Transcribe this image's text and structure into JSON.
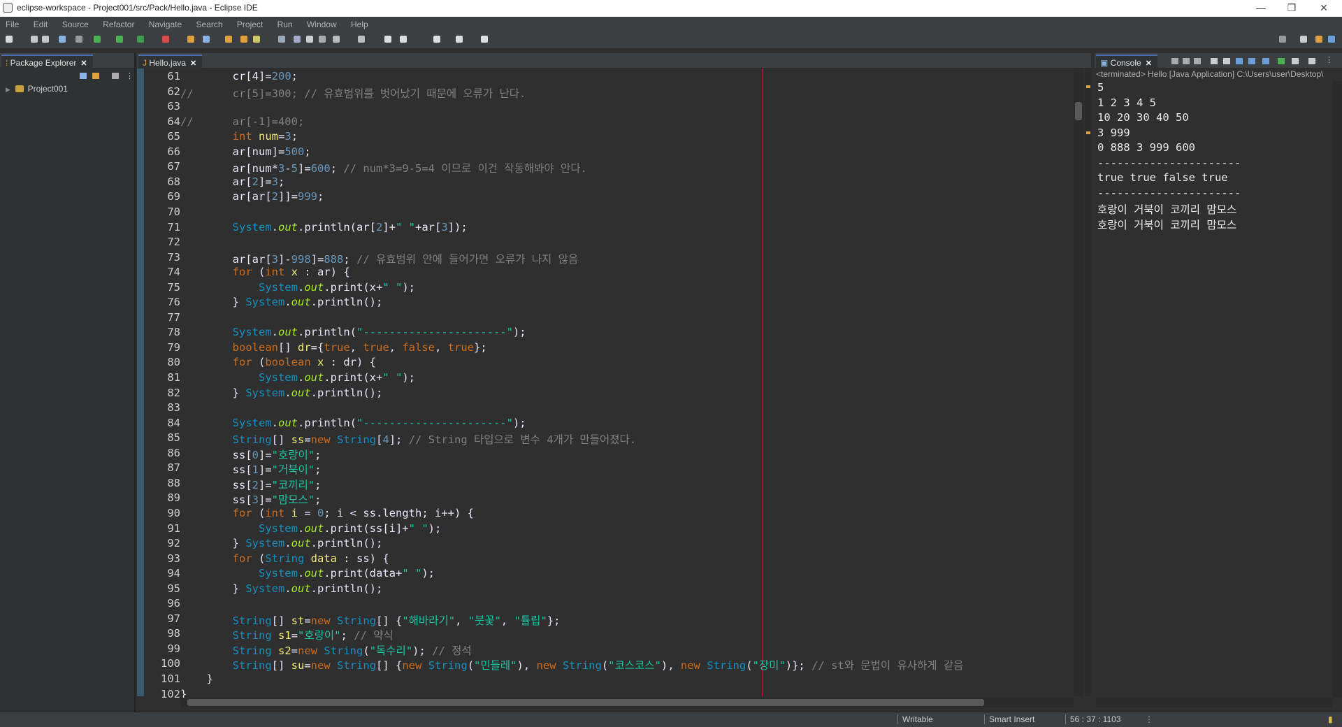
{
  "window": {
    "title": "eclipse-workspace - Project001/src/Pack/Hello.java - Eclipse IDE",
    "minimize": "—",
    "restore": "❐",
    "close": "✕"
  },
  "menu": [
    "File",
    "Edit",
    "Source",
    "Refactor",
    "Navigate",
    "Search",
    "Project",
    "Run",
    "Window",
    "Help"
  ],
  "package_explorer": {
    "tab_label": "Package Explorer",
    "tree": [
      {
        "label": "Project001"
      }
    ]
  },
  "editor": {
    "tab_label": "Hello.java",
    "lines": [
      {
        "n": "61",
        "tokens": [
          [
            "pl",
            "        cr[4]="
          ],
          [
            "num",
            "200"
          ],
          [
            "pl",
            ";"
          ]
        ]
      },
      {
        "n": "62",
        "tokens": [
          [
            "cm",
            "//      cr[5]=300; // 유효범위를 벗어났기 때문에 오류가 난다."
          ]
        ]
      },
      {
        "n": "63",
        "tokens": []
      },
      {
        "n": "64",
        "tokens": [
          [
            "cm",
            "//      ar[-1]=400;"
          ]
        ]
      },
      {
        "n": "65",
        "tokens": [
          [
            "pl",
            "        "
          ],
          [
            "kw",
            "int"
          ],
          [
            "pl",
            " "
          ],
          [
            "vr",
            "num"
          ],
          [
            "pl",
            "="
          ],
          [
            "num",
            "3"
          ],
          [
            "pl",
            ";"
          ]
        ]
      },
      {
        "n": "66",
        "tokens": [
          [
            "pl",
            "        ar[num]="
          ],
          [
            "num",
            "500"
          ],
          [
            "pl",
            ";"
          ]
        ]
      },
      {
        "n": "67",
        "tokens": [
          [
            "pl",
            "        ar[num*"
          ],
          [
            "num",
            "3"
          ],
          [
            "pl",
            "-"
          ],
          [
            "num",
            "5"
          ],
          [
            "pl",
            "]="
          ],
          [
            "num",
            "600"
          ],
          [
            "pl",
            "; "
          ],
          [
            "cm",
            "// num*3=9-5=4 이므로 이건 작동해봐야 안다."
          ]
        ]
      },
      {
        "n": "68",
        "tokens": [
          [
            "pl",
            "        ar["
          ],
          [
            "num",
            "2"
          ],
          [
            "pl",
            "]="
          ],
          [
            "num",
            "3"
          ],
          [
            "pl",
            ";"
          ]
        ]
      },
      {
        "n": "69",
        "tokens": [
          [
            "pl",
            "        ar[ar["
          ],
          [
            "num",
            "2"
          ],
          [
            "pl",
            "]]="
          ],
          [
            "num",
            "999"
          ],
          [
            "pl",
            ";"
          ]
        ]
      },
      {
        "n": "70",
        "tokens": []
      },
      {
        "n": "71",
        "tokens": [
          [
            "pl",
            "        "
          ],
          [
            "cls",
            "System"
          ],
          [
            "pl",
            "."
          ],
          [
            "it",
            "out"
          ],
          [
            "pl",
            ".println(ar["
          ],
          [
            "num",
            "2"
          ],
          [
            "pl",
            "]+"
          ],
          [
            "str",
            "\" \""
          ],
          [
            "pl",
            "+ar["
          ],
          [
            "num",
            "3"
          ],
          [
            "pl",
            "]);"
          ]
        ]
      },
      {
        "n": "72",
        "tokens": []
      },
      {
        "n": "73",
        "tokens": [
          [
            "pl",
            "        ar[ar["
          ],
          [
            "num",
            "3"
          ],
          [
            "pl",
            "]-"
          ],
          [
            "num",
            "998"
          ],
          [
            "pl",
            "]="
          ],
          [
            "num",
            "888"
          ],
          [
            "pl",
            "; "
          ],
          [
            "cm",
            "// 유효범위 안에 들어가면 오류가 나지 않음"
          ]
        ]
      },
      {
        "n": "74",
        "tokens": [
          [
            "pl",
            "        "
          ],
          [
            "kw",
            "for"
          ],
          [
            "pl",
            " ("
          ],
          [
            "kw",
            "int"
          ],
          [
            "pl",
            " "
          ],
          [
            "vr",
            "x"
          ],
          [
            "pl",
            " : ar) {"
          ]
        ]
      },
      {
        "n": "75",
        "tokens": [
          [
            "pl",
            "            "
          ],
          [
            "cls",
            "System"
          ],
          [
            "pl",
            "."
          ],
          [
            "it",
            "out"
          ],
          [
            "pl",
            ".print(x+"
          ],
          [
            "str",
            "\" \""
          ],
          [
            "pl",
            ");"
          ]
        ]
      },
      {
        "n": "76",
        "tokens": [
          [
            "pl",
            "        } "
          ],
          [
            "cls",
            "System"
          ],
          [
            "pl",
            "."
          ],
          [
            "it",
            "out"
          ],
          [
            "pl",
            ".println();"
          ]
        ]
      },
      {
        "n": "77",
        "tokens": []
      },
      {
        "n": "78",
        "tokens": [
          [
            "pl",
            "        "
          ],
          [
            "cls",
            "System"
          ],
          [
            "pl",
            "."
          ],
          [
            "it",
            "out"
          ],
          [
            "pl",
            ".println("
          ],
          [
            "str",
            "\"----------------------\""
          ],
          [
            "pl",
            ");"
          ]
        ]
      },
      {
        "n": "79",
        "tokens": [
          [
            "pl",
            "        "
          ],
          [
            "kw",
            "boolean"
          ],
          [
            "pl",
            "[] "
          ],
          [
            "vr",
            "dr"
          ],
          [
            "pl",
            "={"
          ],
          [
            "kw",
            "true"
          ],
          [
            "pl",
            ", "
          ],
          [
            "kw",
            "true"
          ],
          [
            "pl",
            ", "
          ],
          [
            "kw",
            "false"
          ],
          [
            "pl",
            ", "
          ],
          [
            "kw",
            "true"
          ],
          [
            "pl",
            "};"
          ]
        ]
      },
      {
        "n": "80",
        "tokens": [
          [
            "pl",
            "        "
          ],
          [
            "kw",
            "for"
          ],
          [
            "pl",
            " ("
          ],
          [
            "kw",
            "boolean"
          ],
          [
            "pl",
            " "
          ],
          [
            "vr",
            "x"
          ],
          [
            "pl",
            " : dr) {"
          ]
        ]
      },
      {
        "n": "81",
        "tokens": [
          [
            "pl",
            "            "
          ],
          [
            "cls",
            "System"
          ],
          [
            "pl",
            "."
          ],
          [
            "it",
            "out"
          ],
          [
            "pl",
            ".print(x+"
          ],
          [
            "str",
            "\" \""
          ],
          [
            "pl",
            ");"
          ]
        ]
      },
      {
        "n": "82",
        "tokens": [
          [
            "pl",
            "        } "
          ],
          [
            "cls",
            "System"
          ],
          [
            "pl",
            "."
          ],
          [
            "it",
            "out"
          ],
          [
            "pl",
            ".println();"
          ]
        ]
      },
      {
        "n": "83",
        "tokens": []
      },
      {
        "n": "84",
        "tokens": [
          [
            "pl",
            "        "
          ],
          [
            "cls",
            "System"
          ],
          [
            "pl",
            "."
          ],
          [
            "it",
            "out"
          ],
          [
            "pl",
            ".println("
          ],
          [
            "str",
            "\"----------------------\""
          ],
          [
            "pl",
            ");"
          ]
        ]
      },
      {
        "n": "85",
        "tokens": [
          [
            "pl",
            "        "
          ],
          [
            "cls",
            "String"
          ],
          [
            "pl",
            "[] "
          ],
          [
            "vr",
            "ss"
          ],
          [
            "pl",
            "="
          ],
          [
            "kw",
            "new"
          ],
          [
            "pl",
            " "
          ],
          [
            "cls",
            "String"
          ],
          [
            "pl",
            "["
          ],
          [
            "num",
            "4"
          ],
          [
            "pl",
            "]; "
          ],
          [
            "cm",
            "// String 타입으로 변수 4개가 만들어졌다."
          ]
        ]
      },
      {
        "n": "86",
        "tokens": [
          [
            "pl",
            "        ss["
          ],
          [
            "num",
            "0"
          ],
          [
            "pl",
            "]="
          ],
          [
            "str",
            "\"호랑이\""
          ],
          [
            "pl",
            ";"
          ]
        ]
      },
      {
        "n": "87",
        "tokens": [
          [
            "pl",
            "        ss["
          ],
          [
            "num",
            "1"
          ],
          [
            "pl",
            "]="
          ],
          [
            "str",
            "\"거북이\""
          ],
          [
            "pl",
            ";"
          ]
        ]
      },
      {
        "n": "88",
        "tokens": [
          [
            "pl",
            "        ss["
          ],
          [
            "num",
            "2"
          ],
          [
            "pl",
            "]="
          ],
          [
            "str",
            "\"코끼리\""
          ],
          [
            "pl",
            ";"
          ]
        ]
      },
      {
        "n": "89",
        "tokens": [
          [
            "pl",
            "        ss["
          ],
          [
            "num",
            "3"
          ],
          [
            "pl",
            "]="
          ],
          [
            "str",
            "\"맘모스\""
          ],
          [
            "pl",
            ";"
          ]
        ]
      },
      {
        "n": "90",
        "tokens": [
          [
            "pl",
            "        "
          ],
          [
            "kw",
            "for"
          ],
          [
            "pl",
            " ("
          ],
          [
            "kw",
            "int"
          ],
          [
            "pl",
            " "
          ],
          [
            "vr",
            "i"
          ],
          [
            "pl",
            " = "
          ],
          [
            "num",
            "0"
          ],
          [
            "pl",
            "; i < ss.length; i++) {"
          ]
        ]
      },
      {
        "n": "91",
        "tokens": [
          [
            "pl",
            "            "
          ],
          [
            "cls",
            "System"
          ],
          [
            "pl",
            "."
          ],
          [
            "it",
            "out"
          ],
          [
            "pl",
            ".print(ss[i]+"
          ],
          [
            "str",
            "\" \""
          ],
          [
            "pl",
            ");"
          ]
        ]
      },
      {
        "n": "92",
        "tokens": [
          [
            "pl",
            "        } "
          ],
          [
            "cls",
            "System"
          ],
          [
            "pl",
            "."
          ],
          [
            "it",
            "out"
          ],
          [
            "pl",
            ".println();"
          ]
        ]
      },
      {
        "n": "93",
        "tokens": [
          [
            "pl",
            "        "
          ],
          [
            "kw",
            "for"
          ],
          [
            "pl",
            " ("
          ],
          [
            "cls",
            "String"
          ],
          [
            "pl",
            " "
          ],
          [
            "vr",
            "data"
          ],
          [
            "pl",
            " : ss) {"
          ]
        ]
      },
      {
        "n": "94",
        "tokens": [
          [
            "pl",
            "            "
          ],
          [
            "cls",
            "System"
          ],
          [
            "pl",
            "."
          ],
          [
            "it",
            "out"
          ],
          [
            "pl",
            ".print(data+"
          ],
          [
            "str",
            "\" \""
          ],
          [
            "pl",
            ");"
          ]
        ]
      },
      {
        "n": "95",
        "tokens": [
          [
            "pl",
            "        } "
          ],
          [
            "cls",
            "System"
          ],
          [
            "pl",
            "."
          ],
          [
            "it",
            "out"
          ],
          [
            "pl",
            ".println();"
          ]
        ]
      },
      {
        "n": "96",
        "tokens": []
      },
      {
        "n": "97",
        "tokens": [
          [
            "pl",
            "        "
          ],
          [
            "cls",
            "String"
          ],
          [
            "pl",
            "[] "
          ],
          [
            "vr",
            "st"
          ],
          [
            "pl",
            "="
          ],
          [
            "kw",
            "new"
          ],
          [
            "pl",
            " "
          ],
          [
            "cls",
            "String"
          ],
          [
            "pl",
            "[] {"
          ],
          [
            "str",
            "\"해바라기\""
          ],
          [
            "pl",
            ", "
          ],
          [
            "str",
            "\"붓꽃\""
          ],
          [
            "pl",
            ", "
          ],
          [
            "str",
            "\"튤립\""
          ],
          [
            "pl",
            "};"
          ]
        ]
      },
      {
        "n": "98",
        "tokens": [
          [
            "pl",
            "        "
          ],
          [
            "cls",
            "String"
          ],
          [
            "pl",
            " "
          ],
          [
            "vr",
            "s1"
          ],
          [
            "pl",
            "="
          ],
          [
            "str",
            "\"호랑이\""
          ],
          [
            "pl",
            "; "
          ],
          [
            "cm",
            "// 약식"
          ]
        ]
      },
      {
        "n": "99",
        "tokens": [
          [
            "pl",
            "        "
          ],
          [
            "cls",
            "String"
          ],
          [
            "pl",
            " "
          ],
          [
            "vr",
            "s2"
          ],
          [
            "pl",
            "="
          ],
          [
            "kw",
            "new"
          ],
          [
            "pl",
            " "
          ],
          [
            "cls",
            "String"
          ],
          [
            "pl",
            "("
          ],
          [
            "str",
            "\"독수리\""
          ],
          [
            "pl",
            "); "
          ],
          [
            "cm",
            "// 정석"
          ]
        ]
      },
      {
        "n": "100",
        "tokens": [
          [
            "pl",
            "        "
          ],
          [
            "cls",
            "String"
          ],
          [
            "pl",
            "[] "
          ],
          [
            "vr",
            "su"
          ],
          [
            "pl",
            "="
          ],
          [
            "kw",
            "new"
          ],
          [
            "pl",
            " "
          ],
          [
            "cls",
            "String"
          ],
          [
            "pl",
            "[] {"
          ],
          [
            "kw",
            "new"
          ],
          [
            "pl",
            " "
          ],
          [
            "cls",
            "String"
          ],
          [
            "pl",
            "("
          ],
          [
            "str",
            "\"민들레\""
          ],
          [
            "pl",
            "), "
          ],
          [
            "kw",
            "new"
          ],
          [
            "pl",
            " "
          ],
          [
            "cls",
            "String"
          ],
          [
            "pl",
            "("
          ],
          [
            "str",
            "\"코스코스\""
          ],
          [
            "pl",
            "), "
          ],
          [
            "kw",
            "new"
          ],
          [
            "pl",
            " "
          ],
          [
            "cls",
            "String"
          ],
          [
            "pl",
            "("
          ],
          [
            "str",
            "\"장미\""
          ],
          [
            "pl",
            ")}; "
          ],
          [
            "cm",
            "// st와 문법이 유사하게 같음"
          ]
        ]
      },
      {
        "n": "101",
        "tokens": [
          [
            "pl",
            "    }"
          ]
        ]
      },
      {
        "n": "102",
        "tokens": [
          [
            "pl",
            "}"
          ]
        ]
      }
    ]
  },
  "console": {
    "tab_label": "Console",
    "header": "<terminated> Hello [Java Application] C:\\Users\\user\\Desktop\\",
    "output": [
      "5",
      "1 2 3 4 5",
      "10 20 30 40 50",
      "3 999",
      "0 888 3 999 600",
      "----------------------",
      "true true false true",
      "----------------------",
      "호랑이 거북이 코끼리 맘모스",
      "호랑이 거북이 코끼리 맘모스"
    ]
  },
  "status": {
    "writable": "Writable",
    "insert_mode": "Smart Insert",
    "position": "56 : 37 : 1103"
  },
  "colors": {
    "keyword": "#cc6c1d",
    "number": "#6897bb",
    "string": "#17c6a3",
    "comment": "#808080",
    "class": "#1290c3",
    "static_field": "#a7ec21",
    "variable": "#f3ec79"
  }
}
